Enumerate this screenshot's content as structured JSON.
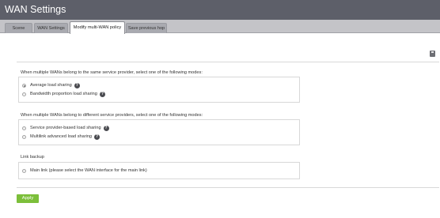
{
  "window": {
    "title": "WAN Settings"
  },
  "tabs": [
    {
      "label": "Scene",
      "active": false
    },
    {
      "label": "WAN Settings",
      "active": false
    },
    {
      "label": "Modify multi-WAN policy",
      "active": true
    },
    {
      "label": "Save previous hop",
      "active": false
    }
  ],
  "toolbar": {
    "save_icon": "floppy-disk-icon"
  },
  "sections": {
    "same_provider": {
      "heading": "When multiple WANs belong to the same service provider, select one of the following modes:",
      "options": [
        {
          "label": "Average load sharing",
          "checked": true,
          "help": "?"
        },
        {
          "label": "Bandwidth proportion load sharing",
          "checked": false,
          "help": "?"
        }
      ]
    },
    "different_providers": {
      "heading": "When multiple WANs belong to different service providers, select one of the following modes:",
      "options": [
        {
          "label": "Service provider-based load sharing",
          "checked": false,
          "help": "?"
        },
        {
          "label": "Multilink advanced load sharing",
          "checked": false,
          "help": "?"
        }
      ]
    },
    "link_backup": {
      "heading": "Link backup",
      "options": [
        {
          "label": "Main link (please select the WAN interface for the main link)",
          "checked": false
        }
      ]
    }
  },
  "actions": {
    "apply_label": "Apply"
  },
  "colors": {
    "titlebar": "#5d5f69",
    "tabbar": "#c4c4c8",
    "apply_button": "#7cbf3a",
    "help_icon": "#4a4b50"
  }
}
